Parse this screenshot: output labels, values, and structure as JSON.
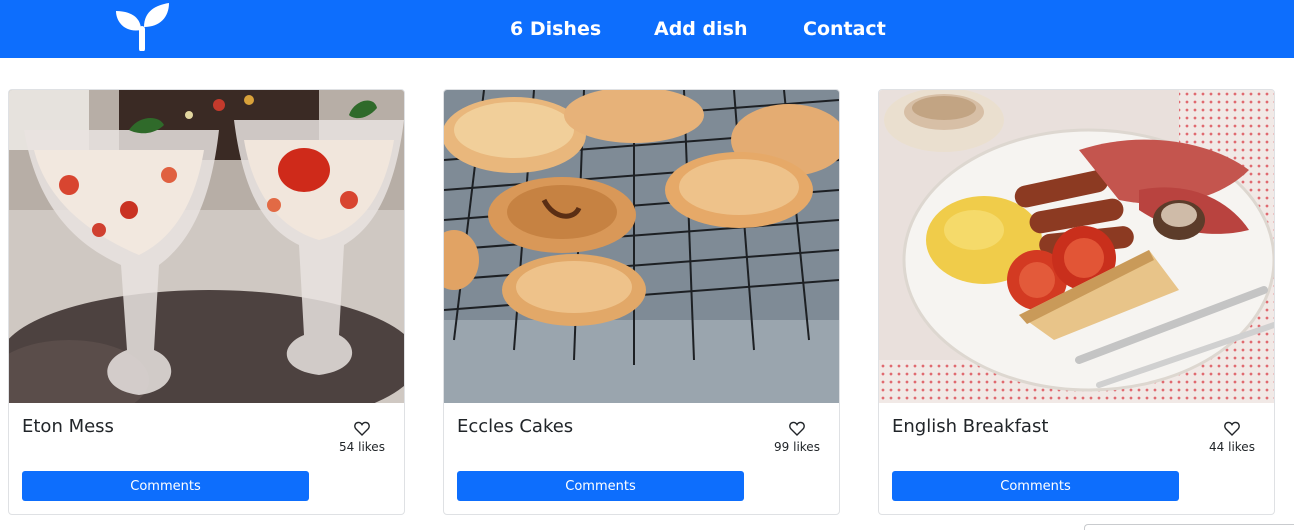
{
  "navbar": {
    "logo_icon": "sprout-icon",
    "links": [
      {
        "label": "6 Dishes"
      },
      {
        "label": "Add dish"
      },
      {
        "label": "Contact"
      }
    ],
    "color": "#0d6efd"
  },
  "dishes": [
    {
      "title": "Eton Mess",
      "likes": "54 likes",
      "button": "Comments",
      "image": "eton-mess-dessert-glasses"
    },
    {
      "title": "Eccles Cakes",
      "likes": "99 likes",
      "button": "Comments",
      "image": "eccles-cakes-on-cooling-rack"
    },
    {
      "title": "English Breakfast",
      "likes": "44 likes",
      "button": "Comments",
      "image": "full-english-breakfast-plate"
    }
  ],
  "icons": {
    "like": "heart-outline-icon"
  }
}
